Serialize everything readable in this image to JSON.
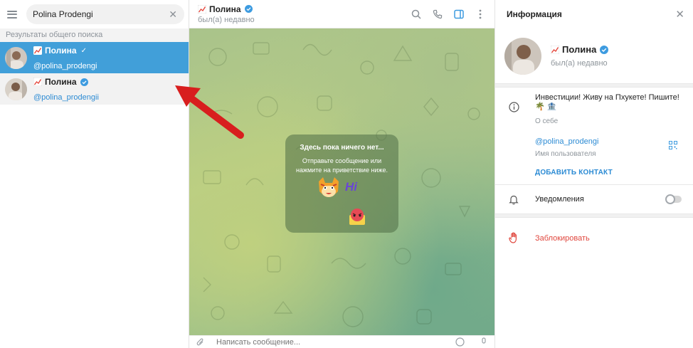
{
  "search": {
    "value": "Polina Prodengi"
  },
  "results": {
    "section_label": "Результаты общего поиска",
    "items": [
      {
        "name": "Полина",
        "handle": "@polina_prodengi"
      },
      {
        "name": "Полина",
        "handle": "@polina_prodengii"
      }
    ]
  },
  "chat": {
    "name": "Полина",
    "status": "был(а) недавно",
    "empty_title": "Здесь пока ничего нет...",
    "empty_sub_1": "Отправьте сообщение или",
    "empty_sub_2": "нажмите на приветствие ниже.",
    "sticker_text": "Hi",
    "composer_placeholder": "Написать сообщение..."
  },
  "info": {
    "title": "Информация",
    "name": "Полина",
    "status": "был(а) недавно",
    "bio": "Инвестиции! Живу на Пхукете! Пишите! 🌴 🏦",
    "bio_label": "О себе",
    "username": "@polina_prodengi",
    "username_label": "Имя пользователя",
    "add_contact": "ДОБАВИТЬ КОНТАКТ",
    "notifications": "Уведомления",
    "notifications_on": false,
    "block": "Заблокировать"
  },
  "colors": {
    "accent": "#419fd9",
    "link": "#2c8bd4",
    "danger": "#e0473e",
    "annotation_arrow": "#d81e1e"
  }
}
